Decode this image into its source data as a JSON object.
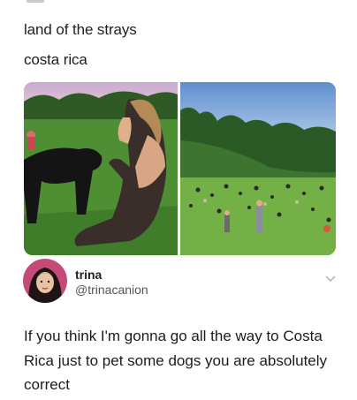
{
  "post": {
    "caption_line1": "land of the strays",
    "caption_line2": "costa rica"
  },
  "tweet": {
    "author_name": "trina",
    "author_handle": "@trinacanion",
    "text": "If you think I'm gonna go all the way to Costa Rica just to pet some dogs you are absolutely correct",
    "menu_icon": "chevron-down-icon"
  },
  "colors": {
    "grass": "#5a9a3a",
    "sky": "#7fa8d8",
    "text": "#1c1c1c",
    "handle": "#555555"
  }
}
